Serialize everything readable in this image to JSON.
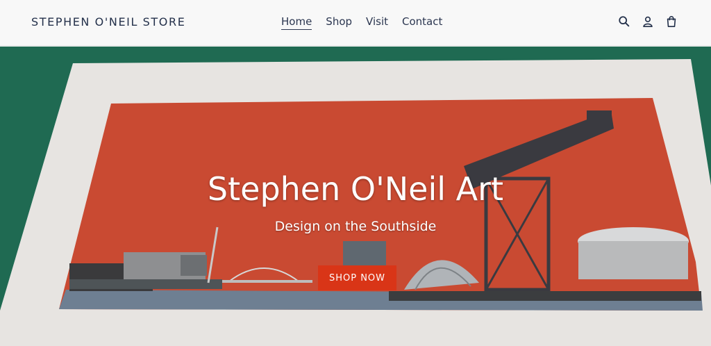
{
  "store": {
    "name": "STEPHEN O'NEIL STORE"
  },
  "nav": {
    "items": [
      {
        "label": "Home"
      },
      {
        "label": "Shop"
      },
      {
        "label": "Visit"
      },
      {
        "label": "Contact"
      }
    ],
    "active": "Home"
  },
  "icons": [
    "search-icon",
    "account-icon",
    "cart-icon"
  ],
  "hero": {
    "title": "Stephen O'Neil Art",
    "subtitle": "Design on the Southside",
    "cta_label": "SHOP NOW"
  },
  "colors": {
    "accent": "#d93517",
    "print_red": "#c94a32",
    "text_dark": "#23304a"
  }
}
